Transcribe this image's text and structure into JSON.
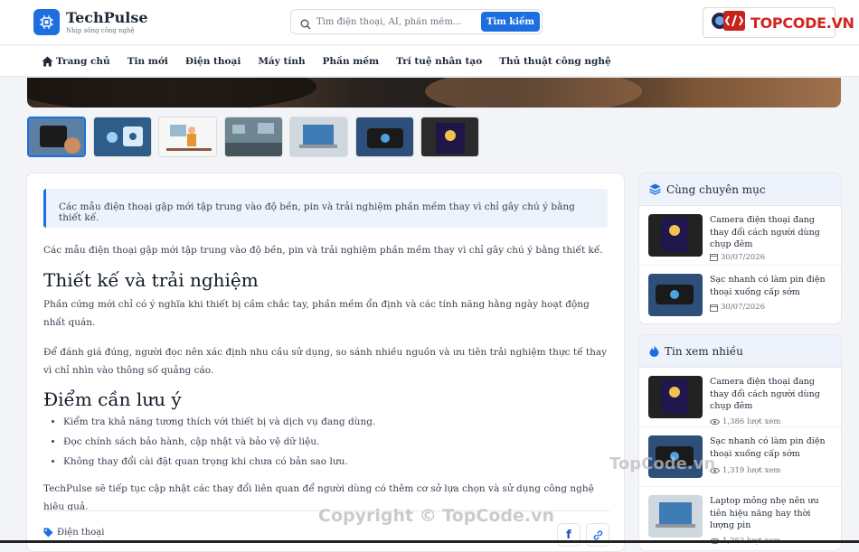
{
  "header": {
    "site_name": "TechPulse",
    "tagline": "Nhịp sống công nghệ",
    "search_placeholder": "Tìm điện thoại, AI, phần mềm...",
    "search_button": "Tìm kiếm",
    "brand_badge": "TOPCODE.VN"
  },
  "nav": {
    "items": [
      {
        "label": "Trang chủ",
        "icon": "home-icon"
      },
      {
        "label": "Tin mới"
      },
      {
        "label": "Điện thoại"
      },
      {
        "label": "Máy tính"
      },
      {
        "label": "Phần mềm"
      },
      {
        "label": "Trí tuệ nhân tạo"
      },
      {
        "label": "Thủ thuật công nghệ"
      }
    ]
  },
  "gallery": {
    "active_index": 0,
    "count": 7
  },
  "article": {
    "summary": "Các mẫu điện thoại gập mới tập trung vào độ bền, pin và trải nghiệm phần mềm thay vì chỉ gây chú ý bằng thiết kế.",
    "intro": "Các mẫu điện thoại gập mới tập trung vào độ bền, pin và trải nghiệm phần mềm thay vì chỉ gây chú ý bằng thiết kế.",
    "h_design": "Thiết kế và trải nghiệm",
    "p_design_1": "Phần cứng mới chỉ có ý nghĩa khi thiết bị cầm chắc tay, phần mềm ổn định và các tính năng hằng ngày hoạt động nhất quán.",
    "p_design_2": "Để đánh giá đúng, người đọc nên xác định nhu cầu sử dụng, so sánh nhiều nguồn và ưu tiên trải nghiệm thực tế thay vì chỉ nhìn vào thông số quảng cáo.",
    "h_notes": "Điểm cần lưu ý",
    "notes": [
      "Kiểm tra khả năng tương thích với thiết bị và dịch vụ đang dùng.",
      "Đọc chính sách bảo hành, cập nhật và bảo vệ dữ liệu.",
      "Không thay đổi cài đặt quan trọng khi chưa có bản sao lưu."
    ],
    "outro": "TechPulse sẽ tiếp tục cập nhật các thay đổi liên quan để người dùng có thêm cơ sở lựa chọn và sử dụng công nghệ hiệu quả.",
    "tag": "Điện thoại"
  },
  "sidebar": {
    "related_title": "Cùng chuyên mục",
    "related": [
      {
        "title": "Camera điện thoại đang thay đổi cách người dùng chụp đêm",
        "date": "30/07/2026"
      },
      {
        "title": "Sạc nhanh có làm pin điện thoại xuống cấp sớm",
        "date": "30/07/2026"
      }
    ],
    "popular_title": "Tin xem nhiều",
    "popular": [
      {
        "title": "Camera điện thoại đang thay đổi cách người dùng chụp đêm",
        "views": "1,386 lượt xem"
      },
      {
        "title": "Sạc nhanh có làm pin điện thoại xuống cấp sớm",
        "views": "1,319 lượt xem"
      },
      {
        "title": "Laptop mỏng nhẹ nên ưu tiên hiệu năng hay thời lượng pin",
        "views": "1,252 lượt xem"
      }
    ]
  },
  "watermark": {
    "mid": "TopCode.vn",
    "bottom": "Copyright © TopCode.vn"
  },
  "colors": {
    "accent": "#1d6fe0",
    "brand_red": "#d0261d"
  }
}
